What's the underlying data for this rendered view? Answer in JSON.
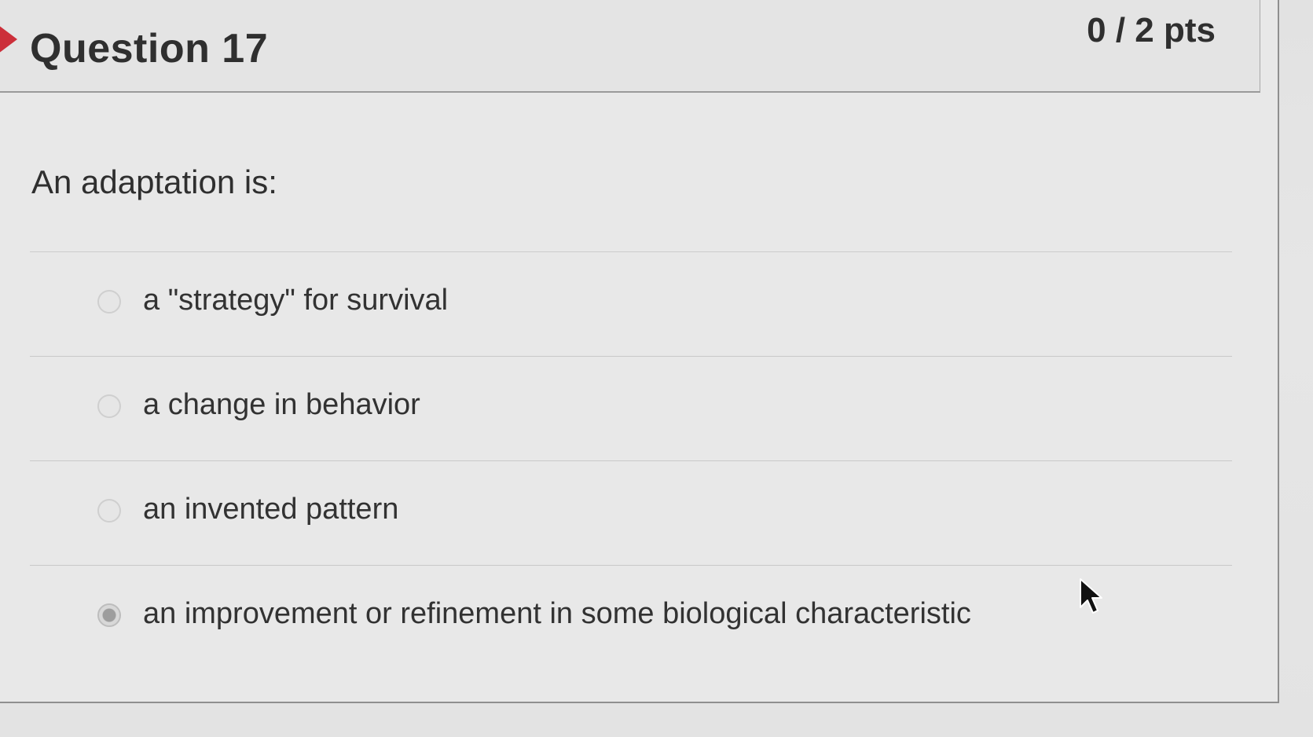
{
  "question": {
    "title": "Question 17",
    "points": "0 / 2 pts",
    "prompt": "An adaptation is:"
  },
  "answers": [
    {
      "label": "a \"strategy\" for survival",
      "selected": false
    },
    {
      "label": "a change in behavior",
      "selected": false
    },
    {
      "label": "an invented pattern",
      "selected": false
    },
    {
      "label": "an improvement or refinement in some biological characteristic",
      "selected": true
    }
  ],
  "colors": {
    "flag": "#cc2f3a",
    "text": "#2f2f2f",
    "background": "#e8e8e8"
  },
  "icons": {
    "flag": "flag-marker-icon",
    "cursor": "mouse-pointer-icon"
  }
}
